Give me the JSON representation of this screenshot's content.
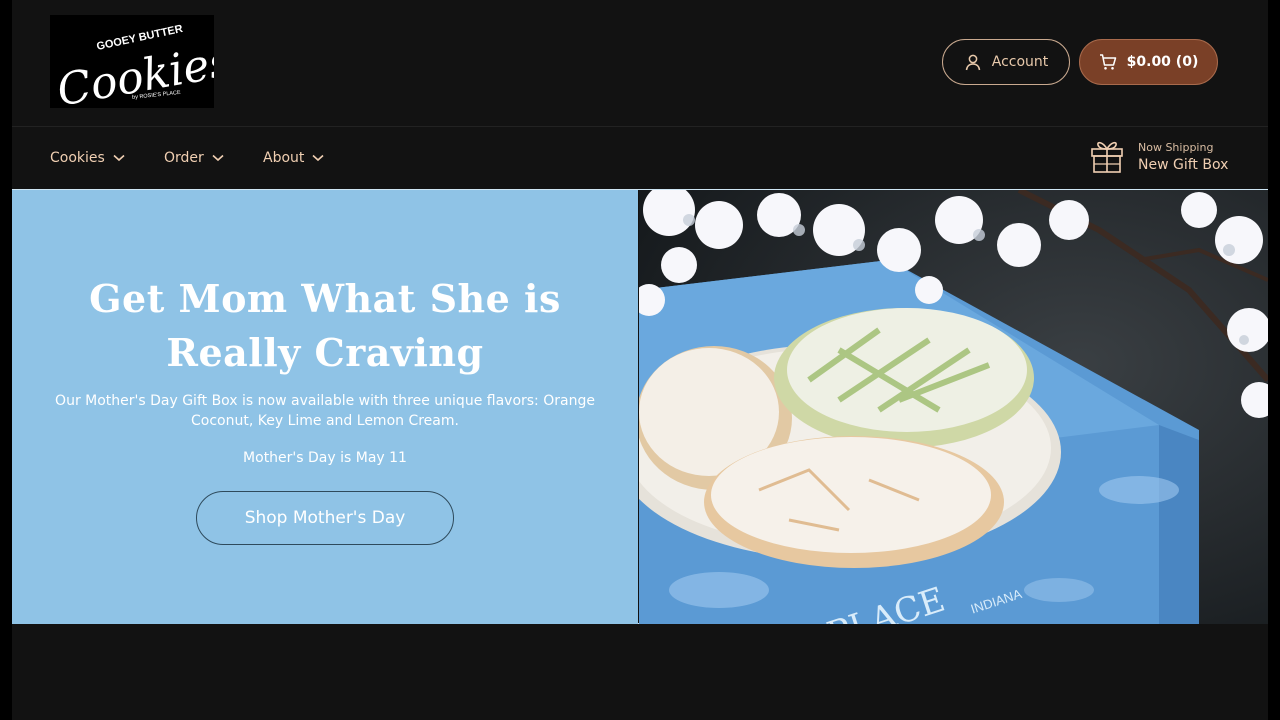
{
  "brand": {
    "logo_line1": "GOOEY BUTTER",
    "logo_line2": "Cookies",
    "logo_line3": "by ROSIE'S PLACE"
  },
  "header": {
    "account_label": "Account",
    "cart_label": "$0.00 (0)"
  },
  "nav": {
    "items": [
      {
        "label": "Cookies"
      },
      {
        "label": "Order"
      },
      {
        "label": "About"
      }
    ],
    "promo_small": "Now Shipping",
    "promo_big": "New Gift Box"
  },
  "hero": {
    "title": "Get Mom What She is Really Craving",
    "description": "Our Mother's Day Gift Box is now available with three unique flavors: Orange Coconut, Key Lime and Lemon Cream.",
    "date_note": "Mother's Day is May 11",
    "cta_label": "Shop Mother's Day",
    "image_box_text_1": "PLACE",
    "image_box_text_2": "INDIANA"
  },
  "colors": {
    "background": "#121212",
    "nav_text": "#f0cfb2",
    "cart_button": "#7a4027",
    "hero_blue": "#8fc3e6"
  }
}
